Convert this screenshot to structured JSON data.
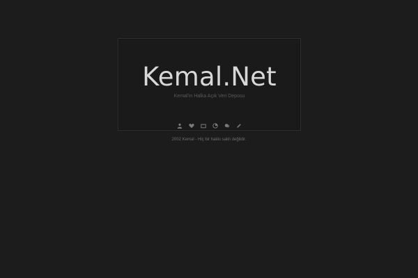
{
  "site": {
    "title": "Kemal.Net",
    "tagline": "Kemal'in Halka Açık Veri Deposu"
  },
  "nav": {
    "icons": [
      {
        "name": "user-icon"
      },
      {
        "name": "heart-icon"
      },
      {
        "name": "folder-icon"
      },
      {
        "name": "pie-chart-icon"
      },
      {
        "name": "chat-icon"
      },
      {
        "name": "pencil-icon"
      }
    ]
  },
  "footer": {
    "text": "2002 Kemal - Hiç bir hakkı saklı değildir."
  },
  "colors": {
    "background": "#1c1c1c",
    "title": "#d8d8d8",
    "icon": "#7b7b7b"
  }
}
